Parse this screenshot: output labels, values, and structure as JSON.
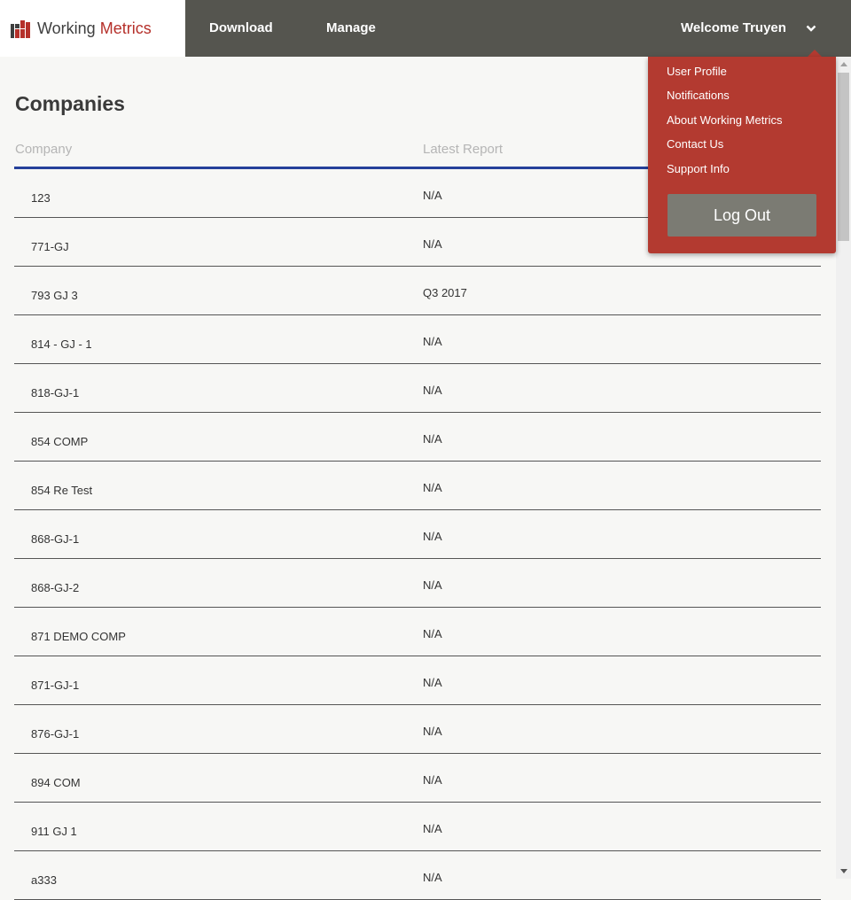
{
  "header": {
    "logo_word1": "Working",
    "logo_word2": "Metrics",
    "nav": {
      "download": "Download",
      "manage": "Manage"
    },
    "welcome": "Welcome Truyen"
  },
  "user_menu": {
    "items": [
      "User Profile",
      "Notifications",
      "About Working Metrics",
      "Contact Us",
      "Support Info"
    ],
    "logout": "Log Out"
  },
  "page": {
    "title": "Companies",
    "columns": {
      "company": "Company",
      "latest_report": "Latest Report"
    }
  },
  "rows": [
    {
      "company": "123",
      "latest_report": "N/A"
    },
    {
      "company": "771-GJ",
      "latest_report": "N/A"
    },
    {
      "company": "793 GJ 3",
      "latest_report": "Q3 2017"
    },
    {
      "company": "814 - GJ - 1",
      "latest_report": "N/A"
    },
    {
      "company": "818-GJ-1",
      "latest_report": "N/A"
    },
    {
      "company": "854 COMP",
      "latest_report": "N/A"
    },
    {
      "company": "854 Re Test",
      "latest_report": "N/A"
    },
    {
      "company": "868-GJ-1",
      "latest_report": "N/A"
    },
    {
      "company": "868-GJ-2",
      "latest_report": "N/A"
    },
    {
      "company": "871 DEMO COMP",
      "latest_report": "N/A"
    },
    {
      "company": "871-GJ-1",
      "latest_report": "N/A"
    },
    {
      "company": "876-GJ-1",
      "latest_report": "N/A"
    },
    {
      "company": "894 COM",
      "latest_report": "N/A"
    },
    {
      "company": "911 GJ 1",
      "latest_report": "N/A"
    },
    {
      "company": "a333",
      "latest_report": "N/A"
    }
  ],
  "colors": {
    "topbar": "#55554f",
    "brand_red": "#b5302a",
    "menu_bg": "#b33a30",
    "header_rule": "#25409a",
    "logout_bg": "#7b7b73"
  },
  "icons": {
    "logo": "working-metrics-logo-icon",
    "menu_toggle": "chevron-down-icon"
  }
}
